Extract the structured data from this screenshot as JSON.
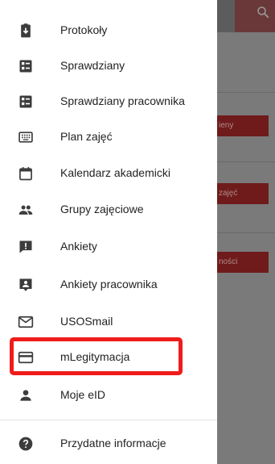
{
  "drawer": {
    "items": [
      {
        "label": "Protokoły",
        "icon": "clipboard-download-icon"
      },
      {
        "label": "Sprawdziany",
        "icon": "test-form-icon"
      },
      {
        "label": "Sprawdziany pracownika",
        "icon": "test-form-icon"
      },
      {
        "label": "Plan zajęć",
        "icon": "keyboard-grid-icon"
      },
      {
        "label": "Kalendarz akademicki",
        "icon": "calendar-icon"
      },
      {
        "label": "Grupy zajęciowe",
        "icon": "people-icon"
      },
      {
        "label": "Ankiety",
        "icon": "feedback-icon"
      },
      {
        "label": "Ankiety pracownika",
        "icon": "feedback-person-icon"
      },
      {
        "label": "USOSmail",
        "icon": "mail-icon"
      },
      {
        "label": "mLegitymacja",
        "icon": "credit-card-icon",
        "highlighted": true
      },
      {
        "label": "Moje eID",
        "icon": "person-icon"
      },
      {
        "label": "Przydatne informacje",
        "icon": "help-circle-icon"
      }
    ]
  },
  "background": {
    "buttons": [
      "ieny",
      "zajęć",
      "ności"
    ]
  },
  "colors": {
    "icon": "#3c3c3c",
    "highlight": "#ef1c1c",
    "button_bg": "#6f1b1b",
    "scrim": "#7a7a7a"
  }
}
